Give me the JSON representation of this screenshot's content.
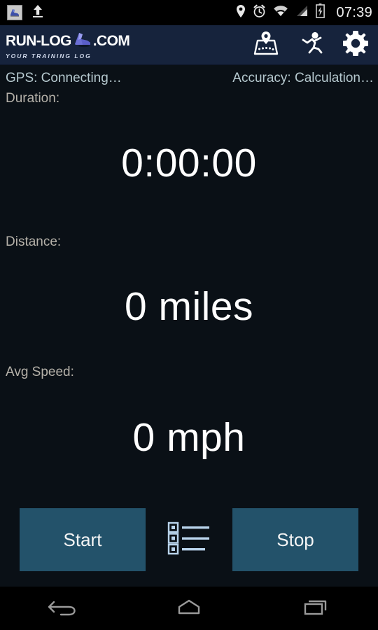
{
  "statusbar": {
    "notification_icons": [
      "shoe-app-icon",
      "upload-icon"
    ],
    "system_icons": [
      "location-pin-icon",
      "alarm-clock-icon",
      "wifi-icon",
      "cell-signal-icon",
      "battery-charging-icon"
    ],
    "time": "07:39"
  },
  "actionbar": {
    "logo_text_left": "RUN-LOG",
    "logo_text_right": ".COM",
    "logo_tagline": "YOUR TRAINING LOG",
    "actions": [
      {
        "name": "map-icon",
        "label": "Map"
      },
      {
        "name": "runner-icon",
        "label": "Run"
      },
      {
        "name": "gear-icon",
        "label": "Settings"
      }
    ],
    "background_color": "#16233c"
  },
  "status": {
    "gps": "GPS: Connecting…",
    "accuracy": "Accuracy: Calculation…",
    "text_color": "#b6c9cf"
  },
  "metrics": [
    {
      "label": "Duration:",
      "value": "0:00:00"
    },
    {
      "label": "Distance:",
      "value": "0 miles"
    },
    {
      "label": "Avg Speed:",
      "value": "0 mph"
    }
  ],
  "controls": {
    "start_label": "Start",
    "stop_label": "Stop",
    "list_icon": "list-icon",
    "button_color": "#23526a"
  },
  "navbar": {
    "back": "back-icon",
    "home": "home-icon",
    "recents": "recents-icon"
  },
  "theme": {
    "background": "#0a1016",
    "accent": "#23526a",
    "label_color": "#b5b1a9",
    "value_color": "#ffffff"
  }
}
